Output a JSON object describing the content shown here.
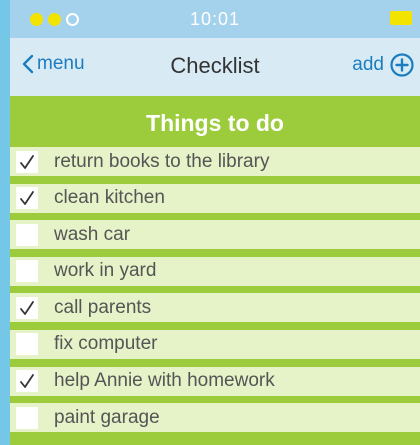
{
  "status_bar": {
    "time": "10:01",
    "signal_dots": [
      "filled",
      "filled",
      "empty"
    ],
    "battery_color": "#f2e400"
  },
  "nav": {
    "back_label": "menu",
    "back_icon": "chevron-left-icon",
    "title": "Checklist",
    "add_label": "add",
    "add_icon": "plus-circle-icon"
  },
  "list": {
    "title": "Things to do",
    "items": [
      {
        "label": "return books to the library",
        "checked": true
      },
      {
        "label": "clean kitchen",
        "checked": true
      },
      {
        "label": "wash car",
        "checked": false
      },
      {
        "label": "work in yard",
        "checked": false
      },
      {
        "label": "call parents",
        "checked": true
      },
      {
        "label": "fix computer",
        "checked": false
      },
      {
        "label": "help Annie with homework",
        "checked": true
      },
      {
        "label": "paint garage",
        "checked": false
      }
    ]
  },
  "colors": {
    "accent_green": "#9ccc3c",
    "row_bg": "#e6f2c8",
    "link_blue": "#1b7dbf",
    "page_bg": "#74c7e7"
  }
}
